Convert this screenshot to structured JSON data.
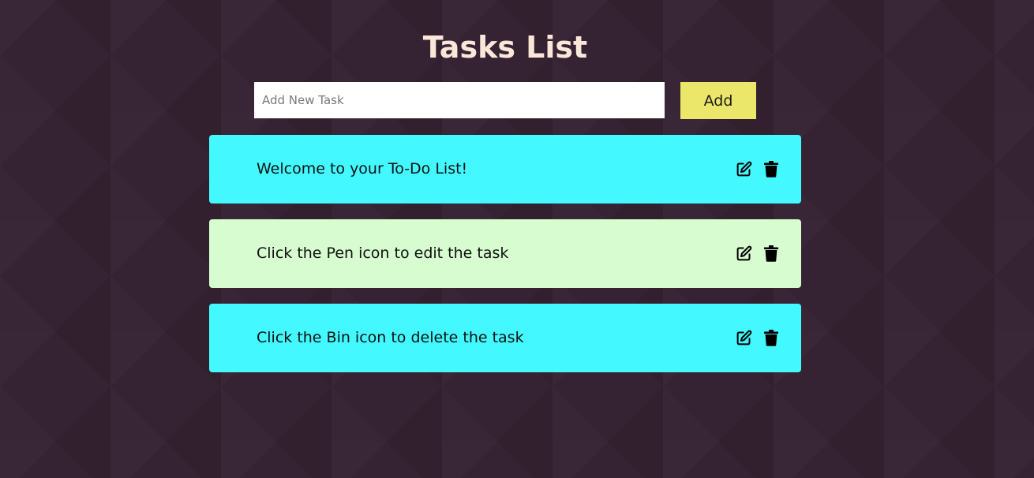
{
  "header": {
    "title": "Tasks List"
  },
  "form": {
    "placeholder": "Add New Task",
    "value": "",
    "add_label": "Add"
  },
  "tasks": [
    {
      "text": "Welcome to your To-Do List!",
      "color": "#43f9ff"
    },
    {
      "text": "Click the Pen icon to edit the task",
      "color": "#d7fcd0"
    },
    {
      "text": "Click the Bin icon to delete the task",
      "color": "#43f9ff"
    }
  ],
  "icons": {
    "edit": "pen-to-square-icon",
    "delete": "trash-bin-icon"
  },
  "colors": {
    "background": "#352232",
    "title": "#fbe7d9",
    "add_button": "#ebe76b",
    "task_cyan": "#43f9ff",
    "task_mint": "#d7fcd0"
  }
}
